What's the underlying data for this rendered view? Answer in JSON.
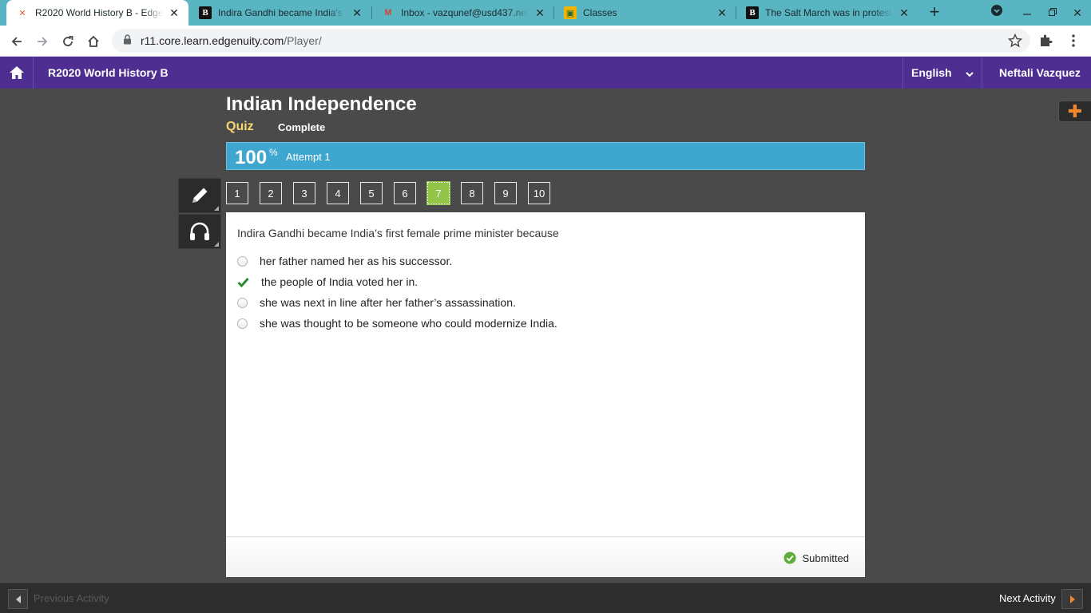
{
  "browser": {
    "tabs": [
      {
        "title": "R2020 World History B - Edgenuity",
        "favicon": "edgenuity-icon"
      },
      {
        "title": "Indira Gandhi became India's first",
        "favicon": "brainly-icon"
      },
      {
        "title": "Inbox - vazqunef@usd437.net",
        "favicon": "gmail-icon"
      },
      {
        "title": "Classes",
        "favicon": "classroom-icon"
      },
      {
        "title": "The Salt March was in protest",
        "favicon": "brainly-icon"
      }
    ],
    "url_host": "r11.core.learn.edgenuity.com",
    "url_path": "/Player/"
  },
  "header": {
    "course_title": "R2020 World History B",
    "language": "English",
    "user_name": "Neftali Vazquez"
  },
  "lesson": {
    "title": "Indian Independence",
    "activity_type": "Quiz",
    "status": "Complete",
    "score": "100",
    "score_unit": "%",
    "attempt": "Attempt 1"
  },
  "question_nav": [
    "1",
    "2",
    "3",
    "4",
    "5",
    "6",
    "7",
    "8",
    "9",
    "10"
  ],
  "current_question": "7",
  "question": {
    "text": "Indira Gandhi became India’s first female prime minister because",
    "answers": [
      "her father named her as his successor.",
      "the people of India voted her in.",
      "she was next in line after her father’s assassination.",
      "she was thought to be someone who could modernize India."
    ],
    "selected_answer": "the people of India voted her in."
  },
  "footer": {
    "submitted": "Submitted",
    "previous": "Previous Activity",
    "next": "Next Activity"
  },
  "colors": {
    "header_purple": "#4f2e92",
    "score_blue": "#3fa6cf",
    "current_question_green": "#93c54b",
    "quiz_label_yellow": "#f7d774",
    "check_green": "#2e8b2e",
    "tab_strip": "#58b5c1"
  }
}
